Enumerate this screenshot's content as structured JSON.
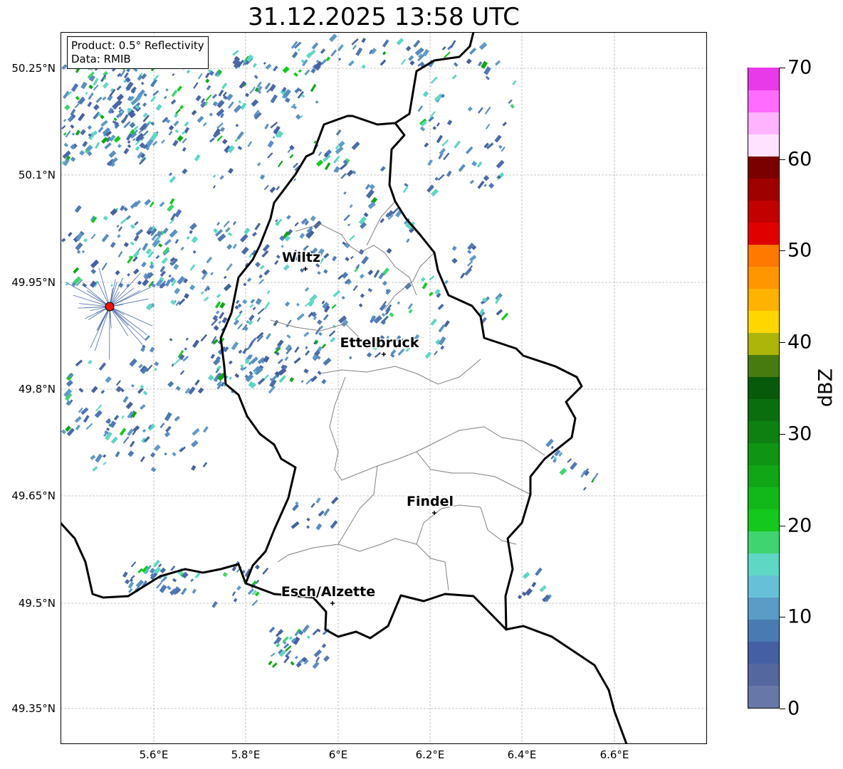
{
  "title": "31.12.2025 13:58 UTC",
  "info": {
    "product": "Product: 0.5° Reflectivity",
    "data_source": "Data: RMIB"
  },
  "lat_labels": [
    "50.25°N",
    "50.1°N",
    "49.95°N",
    "49.8°N",
    "49.65°N",
    "49.5°N",
    "49.35°N"
  ],
  "lon_labels": [
    "5.6°E",
    "5.8°E",
    "6°E",
    "6.2°E",
    "6.4°E",
    "6.6°E"
  ],
  "cities": [
    "Wiltz",
    "Ettelbruck",
    "Findel",
    "Esch/Alzette"
  ],
  "colorbar": {
    "unit": "dBZ",
    "ticks": [
      "70",
      "60",
      "50",
      "40",
      "30",
      "20",
      "10",
      "0"
    ],
    "range": [
      0,
      70
    ],
    "colors": [
      "#6777a8",
      "#55679f",
      "#4460a2",
      "#4a7ab2",
      "#5a9cc6",
      "#66c1d8",
      "#5fd7c5",
      "#3fd470",
      "#14c81e",
      "#12b819",
      "#10a616",
      "#0f9414",
      "#0d8011",
      "#0a6e0f",
      "#085a0b",
      "#477a0f",
      "#adb50a",
      "#ffd600",
      "#ffb200",
      "#ff9600",
      "#ff7800",
      "#e00000",
      "#c20000",
      "#9e0000",
      "#7a0000",
      "#ffe2ff",
      "#ffb3ff",
      "#ff6cff",
      "#e83ae8"
    ]
  },
  "radar_site": "radar-site",
  "grid": true
}
